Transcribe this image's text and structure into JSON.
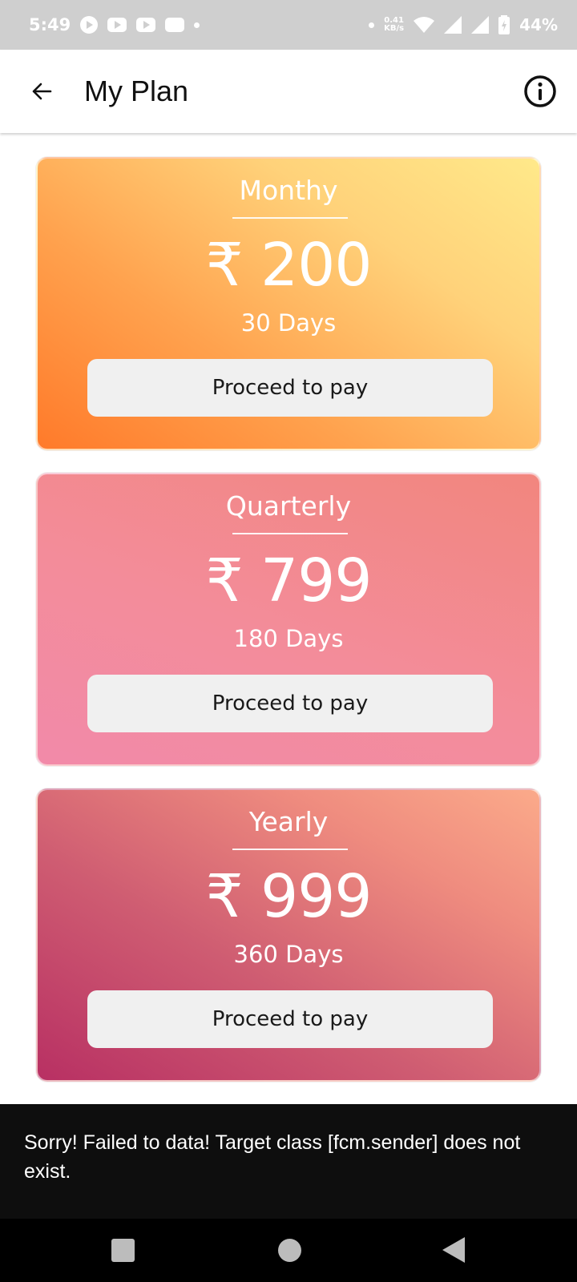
{
  "status_bar": {
    "time": "5:49",
    "speed_value": "0.41",
    "speed_unit": "KB/s",
    "battery": "44%",
    "icons": [
      "app-icon",
      "youtube-icon",
      "youtube-icon",
      "app-icon",
      "wifi-icon",
      "signal-icon",
      "signal-icon",
      "battery-charging-icon"
    ]
  },
  "app_bar": {
    "title": "My Plan",
    "back_icon": "arrow-left-icon",
    "info_icon": "info-icon"
  },
  "plans": [
    {
      "name": "Monthy",
      "price": "₹ 200",
      "duration": "30 Days",
      "button_label": "Proceed to pay"
    },
    {
      "name": "Quarterly",
      "price": "₹ 799",
      "duration": "180 Days",
      "button_label": "Proceed to pay"
    },
    {
      "name": "Yearly",
      "price": "₹ 999",
      "duration": "360 Days",
      "button_label": "Proceed to pay"
    }
  ],
  "snackbar": {
    "message": "Sorry! Failed to data! Target class [fcm.sender] does not exist."
  },
  "nav_bar": {
    "icons": [
      "recent-apps-icon",
      "home-icon",
      "back-icon"
    ]
  },
  "colors": {
    "status_bar_bg": "#cfcfcf",
    "snackbar_bg": "#0e0e0e",
    "button_bg": "#f0f0f0"
  }
}
